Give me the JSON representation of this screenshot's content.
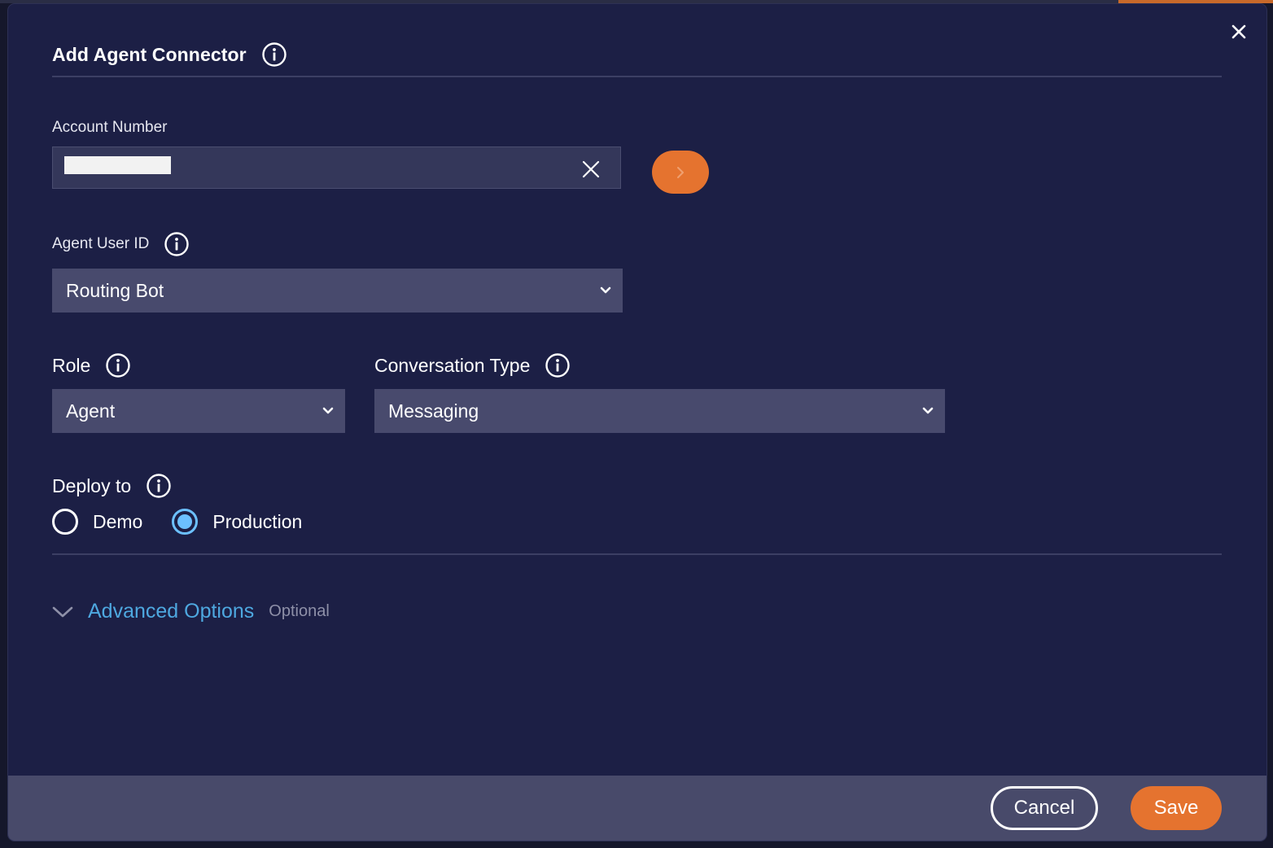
{
  "dialog": {
    "title": "Add Agent Connector",
    "close_icon": "close-icon"
  },
  "fields": {
    "account_number": {
      "label": "Account Number",
      "value": "",
      "clear_icon": "close-icon",
      "submit_icon": "chevron-right-icon"
    },
    "agent_user_id": {
      "label": "Agent User ID",
      "selected": "Routing Bot"
    },
    "role": {
      "label": "Role",
      "selected": "Agent"
    },
    "conversation_type": {
      "label": "Conversation Type",
      "selected": "Messaging"
    },
    "deploy_to": {
      "label": "Deploy to",
      "options": [
        {
          "label": "Demo",
          "checked": false
        },
        {
          "label": "Production",
          "checked": true
        }
      ]
    }
  },
  "advanced": {
    "label": "Advanced Options",
    "hint": "Optional"
  },
  "footer": {
    "cancel_label": "Cancel",
    "save_label": "Save"
  },
  "colors": {
    "modal_bg": "#1c1f45",
    "accent_orange": "#e5732f",
    "link_blue": "#4ea8e0",
    "radio_selected": "#6cc0ff",
    "footer_bg": "#484a6a"
  }
}
